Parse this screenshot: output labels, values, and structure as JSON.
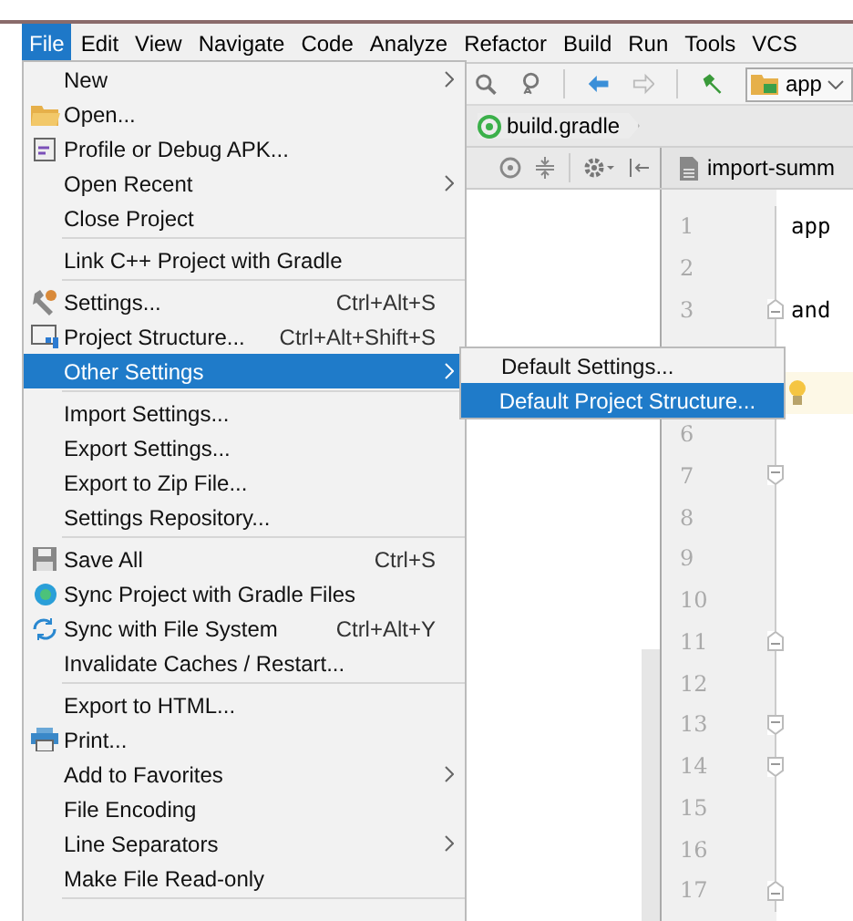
{
  "menu_bar": [
    {
      "label": "File",
      "selected": true
    },
    {
      "label": "Edit",
      "selected": false
    },
    {
      "label": "View",
      "selected": false
    },
    {
      "label": "Navigate",
      "selected": false
    },
    {
      "label": "Code",
      "selected": false
    },
    {
      "label": "Analyze",
      "selected": false
    },
    {
      "label": "Refactor",
      "selected": false
    },
    {
      "label": "Build",
      "selected": false
    },
    {
      "label": "Run",
      "selected": false
    },
    {
      "label": "Tools",
      "selected": false
    },
    {
      "label": "VCS",
      "selected": false
    }
  ],
  "toolbar": {
    "run_config": "app"
  },
  "breadcrumb": "build.gradle",
  "editor": {
    "tab": "import-summ",
    "lines": [
      {
        "kind": "code",
        "number": "1",
        "text": "app"
      },
      {
        "kind": "blank",
        "number": "2"
      },
      {
        "kind": "code",
        "number": "3",
        "text": "and",
        "fold_open": true
      },
      {
        "kind": "blank"
      },
      {
        "kind": "blank",
        "intention": true
      },
      {
        "kind": "blank",
        "number": "6"
      },
      {
        "kind": "blank",
        "number": "7",
        "fold_close": true
      },
      {
        "kind": "blank",
        "number": "8"
      },
      {
        "kind": "blank",
        "number": "9"
      },
      {
        "kind": "blank",
        "number": "10"
      },
      {
        "kind": "blank",
        "number": "11",
        "fold_open": true
      },
      {
        "kind": "blank",
        "number": "12"
      },
      {
        "kind": "blank",
        "number": "13",
        "fold_close": true
      },
      {
        "kind": "blank",
        "number": "14",
        "fold_close": true
      },
      {
        "kind": "blank",
        "number": "15"
      },
      {
        "kind": "blank",
        "number": "16"
      },
      {
        "kind": "blank",
        "number": "17",
        "fold_open": true
      }
    ]
  },
  "file_menu": [
    {
      "kind": "item",
      "label": "New",
      "submenu": true,
      "selected": false
    },
    {
      "kind": "item",
      "label": "Open...",
      "selected": false
    },
    {
      "kind": "item",
      "label": "Profile or Debug APK...",
      "selected": false
    },
    {
      "kind": "item",
      "label": "Open Recent",
      "submenu": true,
      "selected": false
    },
    {
      "kind": "item",
      "label": "Close Project",
      "selected": false
    },
    {
      "kind": "separator"
    },
    {
      "kind": "item",
      "label": "Link C++ Project with Gradle",
      "selected": false
    },
    {
      "kind": "separator"
    },
    {
      "kind": "item",
      "label": "Settings...",
      "shortcut": "Ctrl+Alt+S",
      "selected": false
    },
    {
      "kind": "item",
      "label": "Project Structure...",
      "shortcut": "Ctrl+Alt+Shift+S",
      "selected": false
    },
    {
      "kind": "item",
      "label": "Other Settings",
      "submenu": true,
      "selected": true
    },
    {
      "kind": "separator"
    },
    {
      "kind": "item",
      "label": "Import Settings...",
      "selected": false
    },
    {
      "kind": "item",
      "label": "Export Settings...",
      "selected": false
    },
    {
      "kind": "item",
      "label": "Export to Zip File...",
      "selected": false
    },
    {
      "kind": "item",
      "label": "Settings Repository...",
      "selected": false
    },
    {
      "kind": "separator"
    },
    {
      "kind": "item",
      "label": "Save All",
      "shortcut": "Ctrl+S",
      "selected": false
    },
    {
      "kind": "item",
      "label": "Sync Project with Gradle Files",
      "selected": false
    },
    {
      "kind": "item",
      "label": "Sync with File System",
      "shortcut": "Ctrl+Alt+Y",
      "selected": false
    },
    {
      "kind": "item",
      "label": "Invalidate Caches / Restart...",
      "selected": false
    },
    {
      "kind": "separator"
    },
    {
      "kind": "item",
      "label": "Export to HTML...",
      "selected": false
    },
    {
      "kind": "item",
      "label": "Print...",
      "selected": false
    },
    {
      "kind": "item",
      "label": "Add to Favorites",
      "submenu": true,
      "selected": false
    },
    {
      "kind": "item",
      "label": "File Encoding",
      "selected": false
    },
    {
      "kind": "item",
      "label": "Line Separators",
      "submenu": true,
      "selected": false
    },
    {
      "kind": "item",
      "label": "Make File Read-only",
      "selected": false
    },
    {
      "kind": "separator"
    }
  ],
  "other_settings_submenu": [
    {
      "kind": "item",
      "label": "Default Settings...",
      "selected": false
    },
    {
      "kind": "item",
      "label": "Default Project Structure...",
      "selected": true
    }
  ]
}
